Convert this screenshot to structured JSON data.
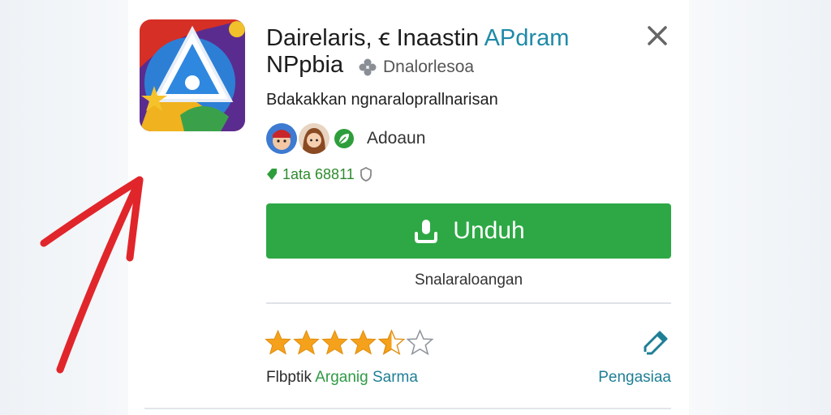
{
  "dialog": {
    "title_part1": "Dairelaris, ꞓ Inaastin ",
    "title_accent": "APdram",
    "title_line2": "NPpbia",
    "developer": "Dnalorlesoa",
    "subtitle": "Bdakakkan ngnaraloprallnarisan",
    "avatars_label": "Adoaun",
    "stat_text": "1ata 68811",
    "download_label": "Unduh",
    "secondary_link": "Snalaraloangan",
    "bottom_left_part1": "Flbptik ",
    "bottom_left_accent": "Arganig",
    "bottom_left_part2": " Sarma",
    "bottom_right_link": "Pengasiaa",
    "rating": 4.5,
    "rating_max": 5
  },
  "colors": {
    "accent_green": "#2ea845",
    "accent_teal": "#1e8aa8",
    "star_orange": "#f5a11b",
    "arrow_red": "#e0262b"
  },
  "icons": [
    "app-icon",
    "close-icon",
    "developer-icon",
    "download-icon",
    "shield-icon",
    "edit-icon",
    "star-icon"
  ]
}
